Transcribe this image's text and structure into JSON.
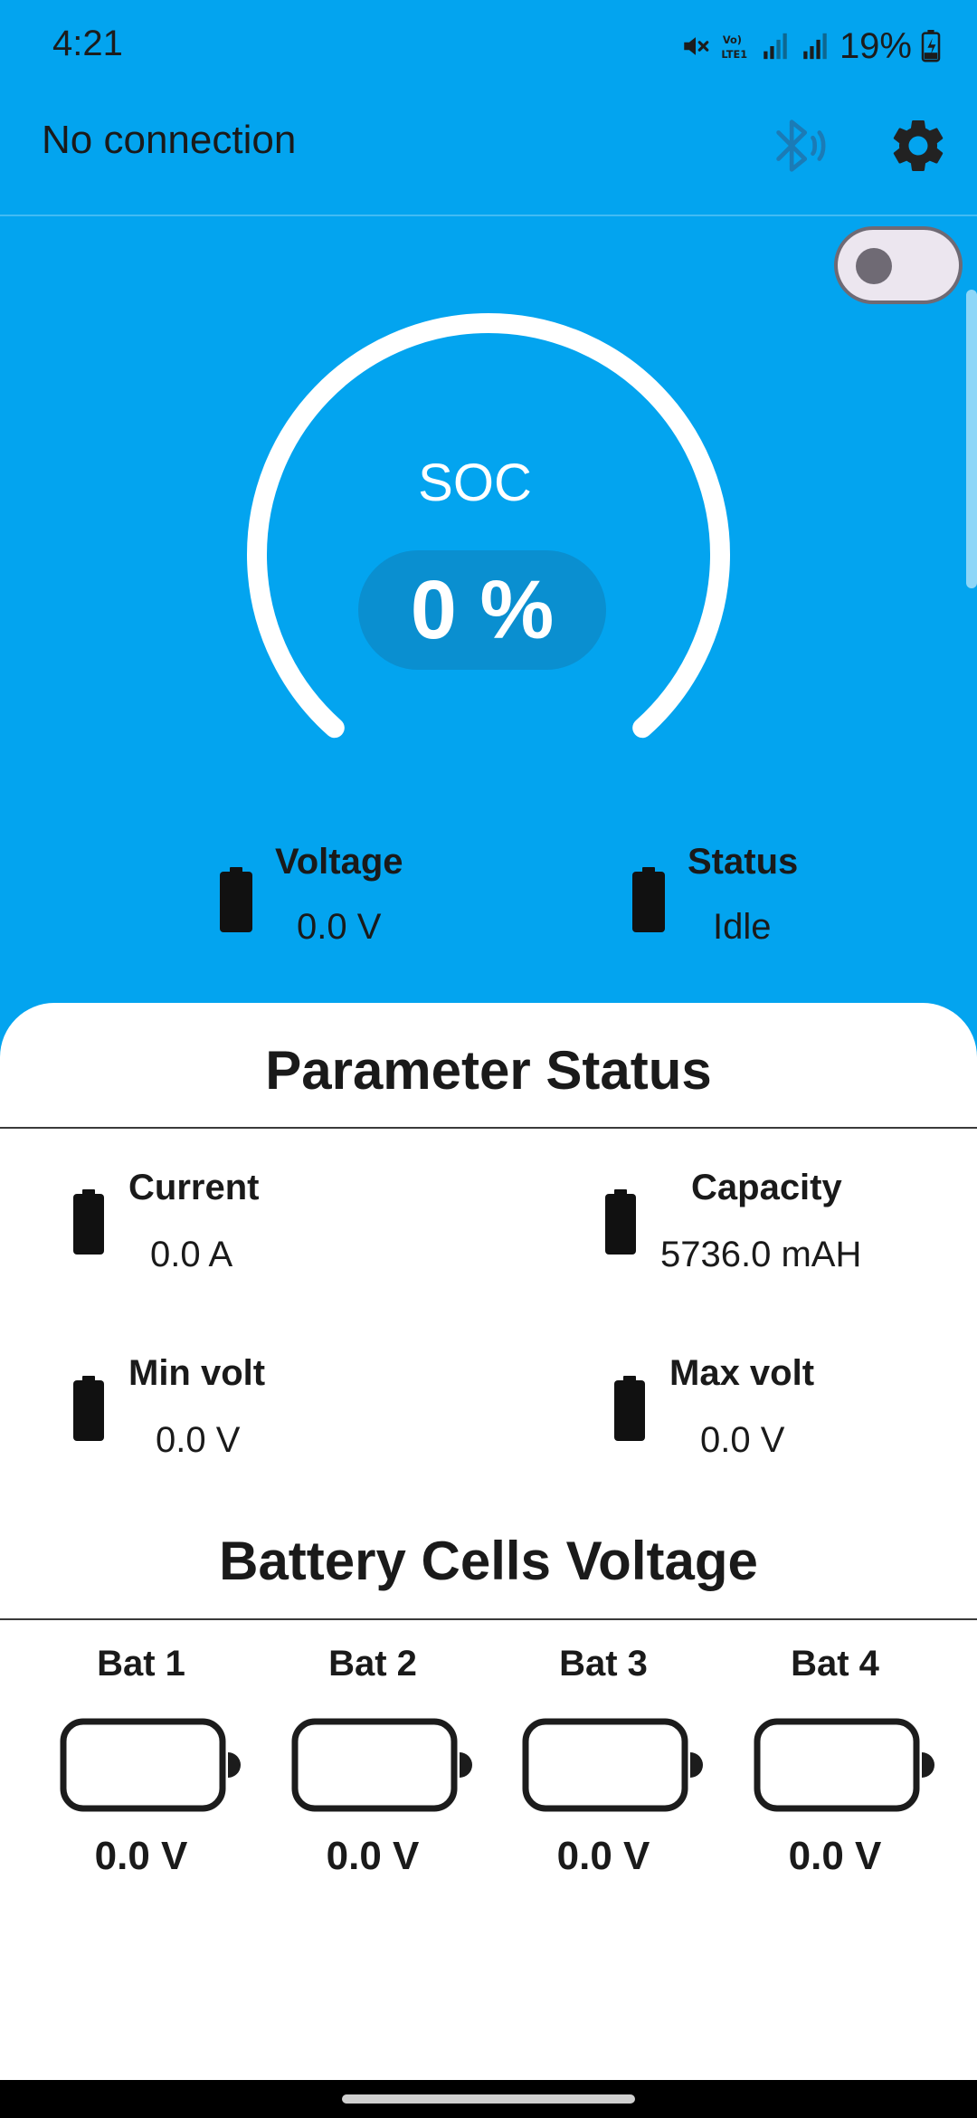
{
  "status_bar": {
    "time": "4:21",
    "battery_percent": "19%",
    "icons": [
      "mute-icon",
      "volte-icon",
      "signal-icon",
      "signal-icon",
      "battery-charging-icon"
    ]
  },
  "app_bar": {
    "connection_status": "No connection",
    "bluetooth_icon": "bluetooth-audio-icon",
    "settings_icon": "gear-icon"
  },
  "toggle": {
    "on": false
  },
  "gauge": {
    "label": "SOC",
    "value": "0 %",
    "level": 0
  },
  "summary": {
    "voltage": {
      "label": "Voltage",
      "value": "0.0 V"
    },
    "status": {
      "label": "Status",
      "value": "Idle"
    }
  },
  "parameter_status": {
    "title": "Parameter Status",
    "items": [
      {
        "label": "Current",
        "value": "0.0 A"
      },
      {
        "label": "Capacity",
        "value": "5736.0 mAH"
      },
      {
        "label": "Min volt",
        "value": "0.0 V"
      },
      {
        "label": "Max volt",
        "value": "0.0 V"
      }
    ]
  },
  "cells": {
    "title": "Battery Cells Voltage",
    "items": [
      {
        "name": "Bat 1",
        "value": "0.0 V"
      },
      {
        "name": "Bat 2",
        "value": "0.0 V"
      },
      {
        "name": "Bat 3",
        "value": "0.0 V"
      },
      {
        "name": "Bat 4",
        "value": "0.0 V"
      }
    ]
  },
  "colors": {
    "primary": "#03a4ef",
    "pill": "#0a8fd0",
    "text": "#1a1a1a",
    "card": "#ffffff"
  }
}
